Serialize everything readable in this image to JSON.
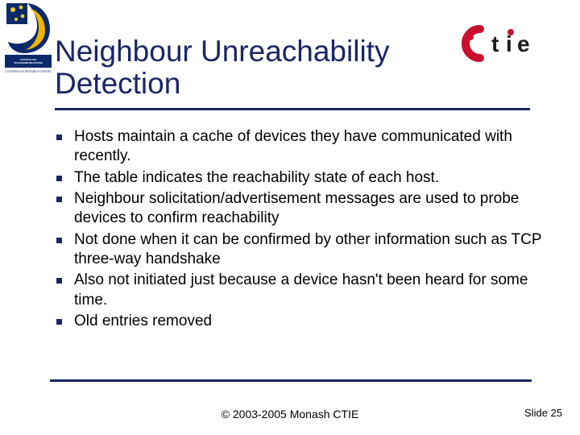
{
  "title": "Neighbour Unreachability Detection",
  "bullets": [
    "Hosts maintain a cache of devices they have communicated with recently.",
    "The table indicates the reachability state of each host.",
    "Neighbour solicitation/advertisement messages are used to probe devices to confirm reachability",
    "Not done when it can be confirmed by other information such as TCP three-way handshake",
    "Also not initiated just because a device hasn't been heard for some time.",
    "Old entries removed"
  ],
  "footer": {
    "copyright": "© 2003-2005 Monash CTIE",
    "slide_label": "Slide 25"
  },
  "logos": {
    "left_alt": "Australian Telecommunications CRC logo",
    "right_alt": "CTIE logo"
  },
  "colors": {
    "accent": "#1a2566",
    "ctie_red": "#c8102e"
  }
}
